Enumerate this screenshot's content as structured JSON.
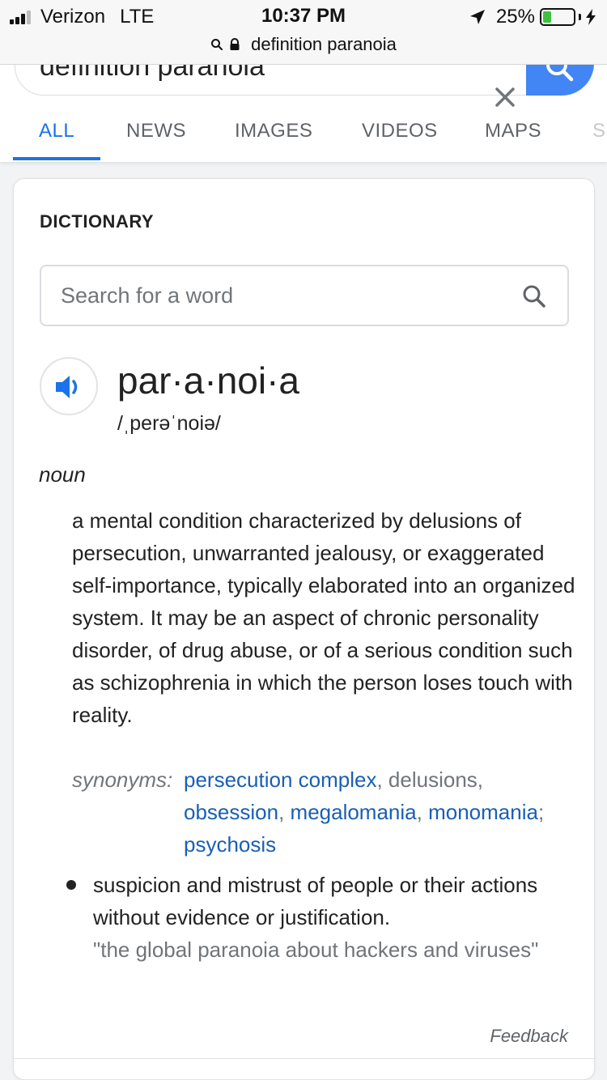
{
  "status_bar": {
    "carrier": "Verizon",
    "network": "LTE",
    "time": "10:37 PM",
    "battery_percent": "25%",
    "battery_level": 0.25,
    "url": "definition paranoia"
  },
  "search": {
    "query": "definition paranoia"
  },
  "tabs": [
    {
      "label": "ALL",
      "active": true
    },
    {
      "label": "NEWS",
      "active": false
    },
    {
      "label": "IMAGES",
      "active": false
    },
    {
      "label": "VIDEOS",
      "active": false
    },
    {
      "label": "MAPS",
      "active": false
    },
    {
      "label": "S",
      "active": false
    }
  ],
  "dictionary": {
    "header": "DICTIONARY",
    "search_placeholder": "Search for a word",
    "headword": "par·a·noi·a",
    "pronunciation": "/ˌperəˈnoiə/",
    "part_of_speech": "noun",
    "definition": "a mental condition characterized by delusions of persecution, unwarranted jealousy, or exaggerated self-importance, typically elaborated into an organized system. It may be an aspect of chronic personality disorder, of drug abuse, or of a serious condition such as schizophrenia in which the person loses touch with reality.",
    "synonyms_label": "synonyms:",
    "synonyms": [
      {
        "text": "persecution complex",
        "link": true,
        "sep": ", "
      },
      {
        "text": "delusions",
        "link": false,
        "sep": ", "
      },
      {
        "text": "obsession",
        "link": true,
        "sep": ", "
      },
      {
        "text": "megalomania",
        "link": true,
        "sep": ", "
      },
      {
        "text": "monomania",
        "link": true,
        "sep": "; "
      },
      {
        "text": "psychosis",
        "link": true,
        "sep": ""
      }
    ],
    "sub_definition": "suspicion and mistrust of people or their actions without evidence or justification.",
    "example": "\"the global paranoia about hackers and viruses\"",
    "feedback": "Feedback"
  },
  "colors": {
    "accent": "#1a73e8",
    "link": "#1a5fb4",
    "search_button": "#4285f4",
    "battery": "#3ec13e"
  }
}
